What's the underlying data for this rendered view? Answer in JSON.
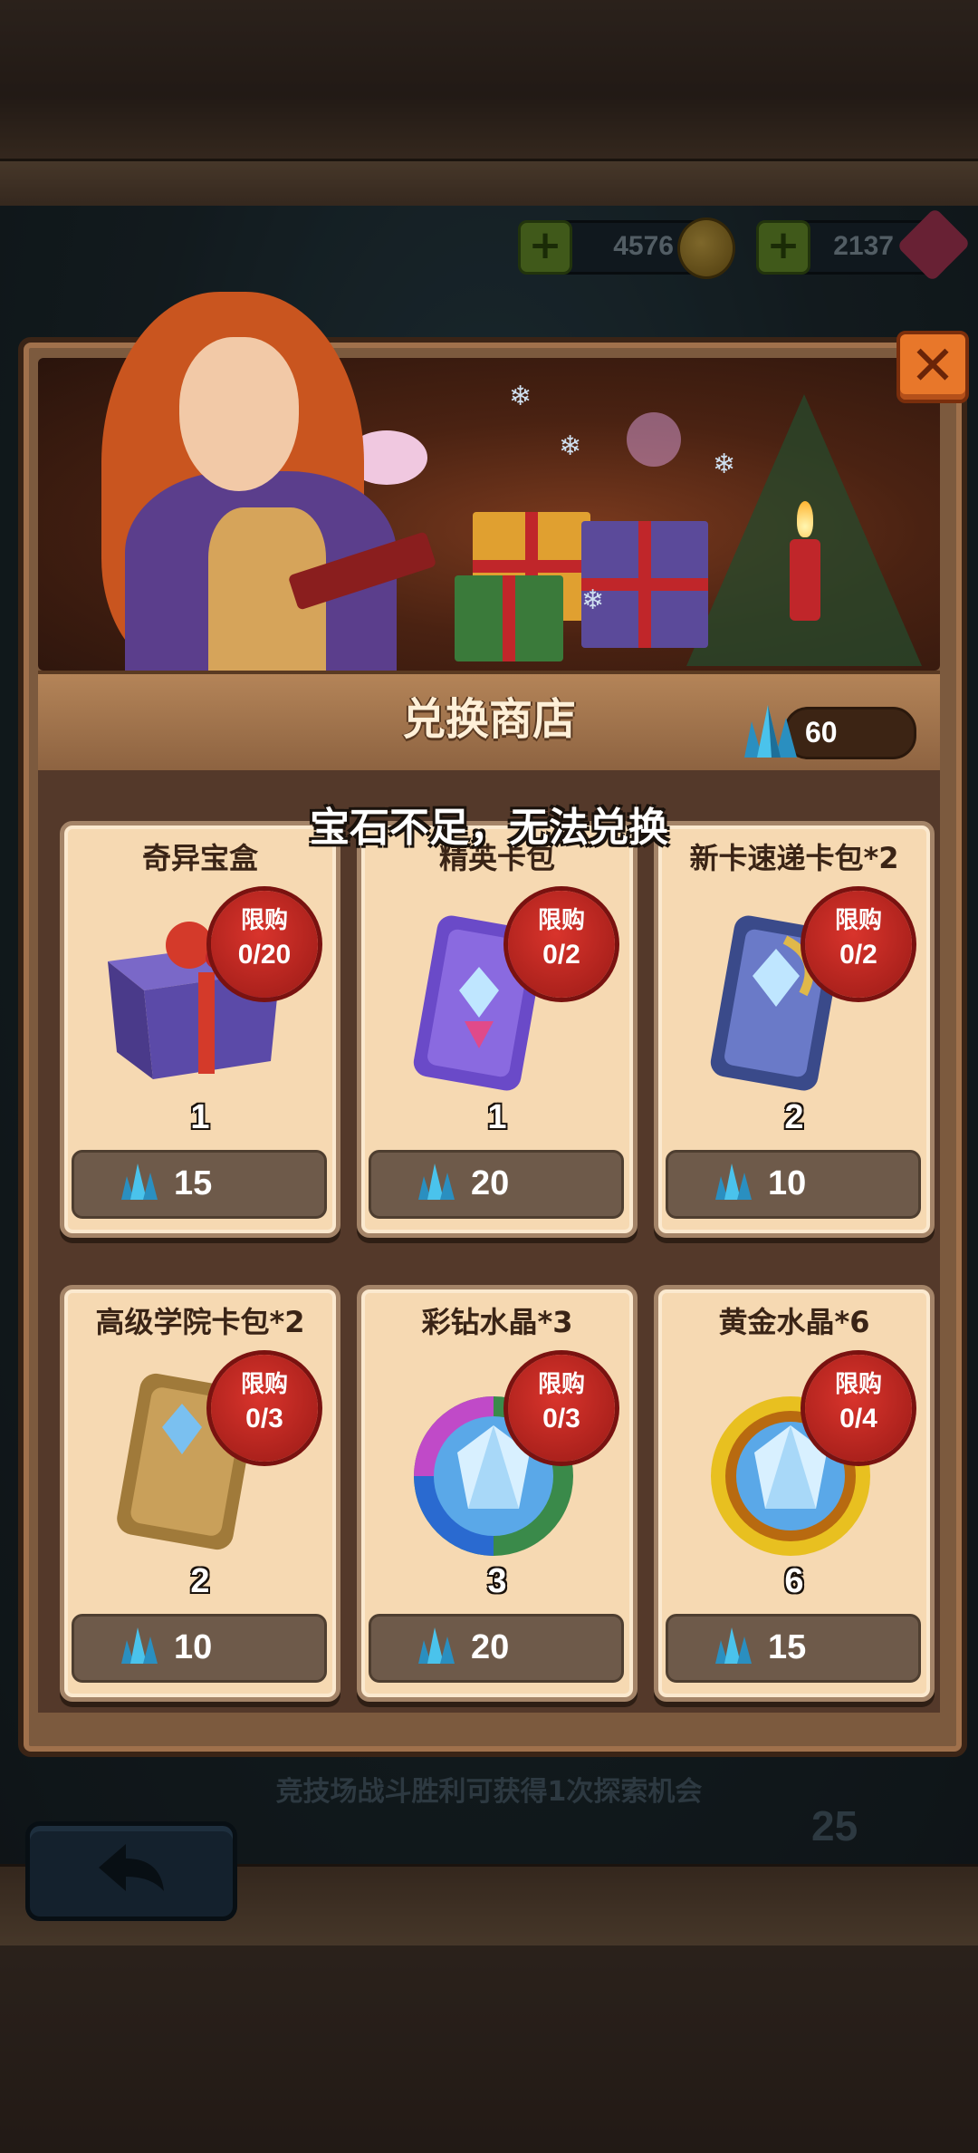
{
  "colors": {
    "panel_brown": "#7c5a3e",
    "card_bg": "#f6d9b2",
    "limit_red": "#c62a22",
    "gem_blue": "#2aa7d6",
    "close_orange": "#e8772a"
  },
  "top_bar": {
    "gold_value": "4576",
    "gem_value": "2137",
    "gold_icon": "gold-coin-icon",
    "gem_icon": "red-gem-icon"
  },
  "shop": {
    "title": "兑换商店",
    "balance": "60",
    "balance_icon": "blue-crystal-icon",
    "toast": "宝石不足，无法兑换",
    "close_icon": "close-icon",
    "limit_label": "限购"
  },
  "items": [
    {
      "name": "奇异宝盒",
      "limit": "0/20",
      "qty": "1",
      "price": "15",
      "icon": "gift-box-icon"
    },
    {
      "name": "精英卡包",
      "limit": "0/2",
      "qty": "1",
      "price": "20",
      "icon": "elite-card-pack-icon"
    },
    {
      "name": "新卡速递卡包*2",
      "limit": "0/2",
      "qty": "2",
      "price": "10",
      "icon": "new-card-pack-icon"
    },
    {
      "name": "高级学院卡包*2",
      "limit": "0/3",
      "qty": "2",
      "price": "10",
      "icon": "academy-card-pack-icon"
    },
    {
      "name": "彩钻水晶*3",
      "limit": "0/3",
      "qty": "3",
      "price": "20",
      "icon": "rainbow-crystal-icon"
    },
    {
      "name": "黄金水晶*6",
      "limit": "0/4",
      "qty": "6",
      "price": "15",
      "icon": "gold-crystal-icon"
    }
  ],
  "background": {
    "info_line": "竞技场战斗胜利可获得1次探索机会",
    "counter": "25",
    "back_icon": "back-arrow-icon"
  }
}
